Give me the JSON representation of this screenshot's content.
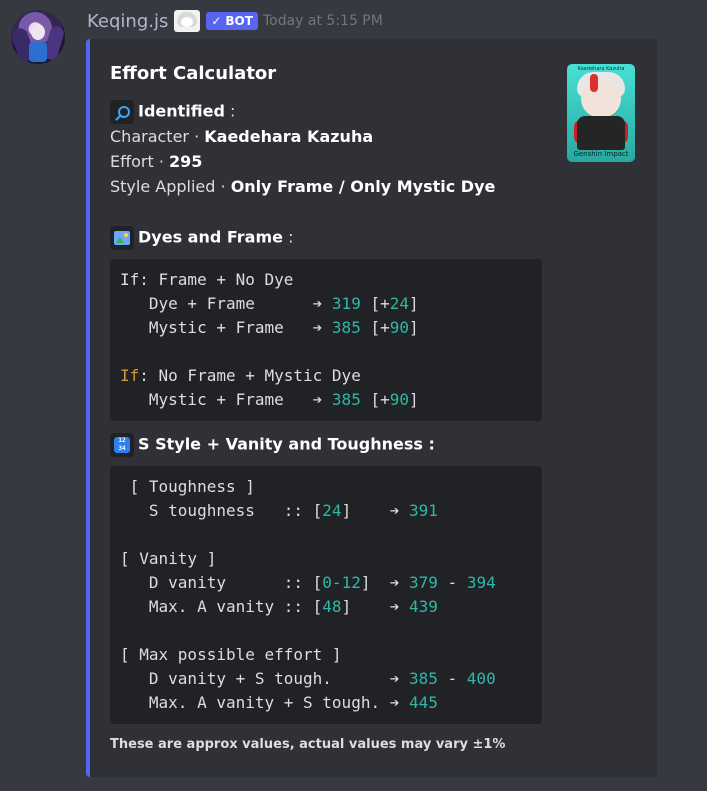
{
  "message": {
    "username": "Keqing.js",
    "bot_badge": "BOT",
    "timestamp": "Today at 5:15 PM"
  },
  "embed": {
    "title": "Effort Calculator",
    "thumbnail": {
      "top_caption": "Kaedehara Kazuha",
      "caption": "Genshin Impact"
    },
    "identified": {
      "header": "Identified",
      "colon": " :",
      "character_label": "Character · ",
      "character_value": "Kaedehara Kazuha",
      "effort_label": "Effort · ",
      "effort_value": "295",
      "style_label": "Style Applied · ",
      "style_value": "Only Frame / Only Mystic Dye"
    },
    "dyes_frame": {
      "header": "Dyes and Frame",
      "colon": " :",
      "code": {
        "line1_prefix": "If: ",
        "line1_text": "Frame + No Dye",
        "line2_label": "   Dye + Frame      ➔ ",
        "line2_value": "319",
        "line2_bonus_open": " [+",
        "line2_bonus": "24",
        "line2_bonus_close": "]",
        "line3_label": "   Mystic + Frame   ➔ ",
        "line3_value": "385",
        "line3_bonus_open": " [+",
        "line3_bonus": "90",
        "line3_bonus_close": "]",
        "line5_prefix": "If",
        "line5_text": ": No Frame + Mystic Dye",
        "line6_label": "   Mystic + Frame   ➔ ",
        "line6_value": "385",
        "line6_bonus_open": " [+",
        "line6_bonus": "90",
        "line6_bonus_close": "]"
      }
    },
    "s_style": {
      "header": "S Style + Vanity and Toughness",
      "colon": " :",
      "code": {
        "toughness_header": " [ Toughness ]",
        "s_tough_label": "   S toughness   :: [",
        "s_tough_bracket": "24",
        "s_tough_mid": "]    ➔ ",
        "s_tough_result": "391",
        "vanity_header": "[ Vanity ]",
        "d_vanity_label": "   D vanity      :: [",
        "d_vanity_bracket": "0-12",
        "d_vanity_mid": "]  ➔ ",
        "d_vanity_result_a": "379",
        "d_vanity_dash": " - ",
        "d_vanity_result_b": "394",
        "max_a_label": "   Max. A vanity :: [",
        "max_a_bracket": "48",
        "max_a_mid": "]    ➔ ",
        "max_a_result": "439",
        "max_effort_header": "[ Max possible effort ]",
        "d_plus_s_label": "   D vanity + S tough.      ➔ ",
        "d_plus_s_result_a": "385",
        "d_plus_s_dash": " - ",
        "d_plus_s_result_b": "400",
        "max_plus_s_label": "   Max. A vanity + S tough. ➔ ",
        "max_plus_s_result": "445"
      }
    },
    "footer": "These are approx values, actual values may vary ±1%"
  }
}
